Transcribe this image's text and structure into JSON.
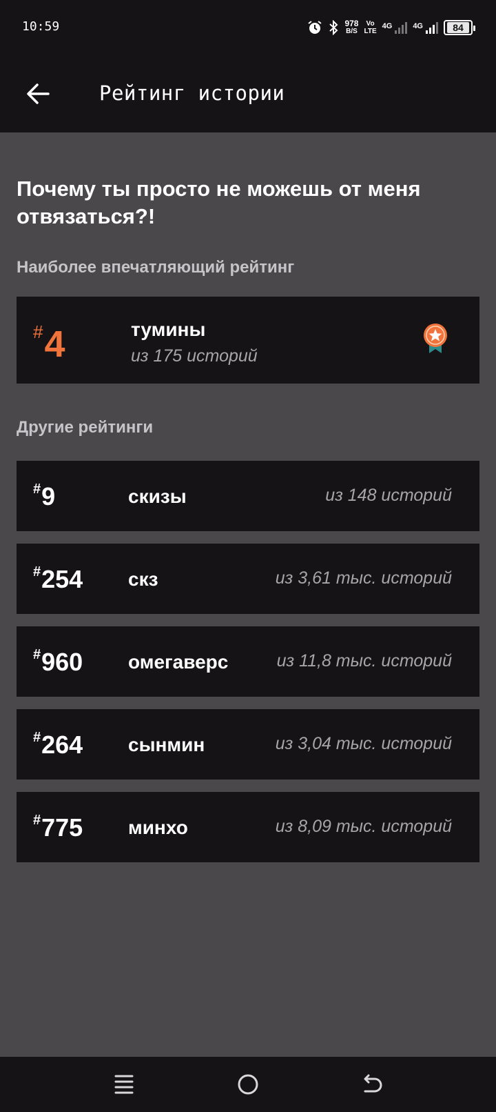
{
  "status_bar": {
    "time": "10:59",
    "speed_value": "978",
    "speed_unit": "B/S",
    "volte_top": "Vo",
    "volte_bottom": "LTE",
    "net1": "4G",
    "net2": "4G",
    "battery": "84",
    "icons": [
      "alarm-icon",
      "bluetooth-icon",
      "signal-icon",
      "battery-icon"
    ]
  },
  "app_bar": {
    "title": "Рейтинг истории",
    "back_icon": "arrow-left-icon"
  },
  "story": {
    "title": "Почему ты просто не можешь от меня отвязаться?!"
  },
  "best": {
    "label": "Наиболее впечатляющий рейтинг",
    "hash": "#",
    "rank": "4",
    "tag": "тумины",
    "count": "из 175 историй",
    "icon": "medal-star-icon",
    "accent": "#f0743b"
  },
  "others": {
    "label": "Другие рейтинги",
    "items": [
      {
        "hash": "#",
        "rank": "9",
        "tag": "скизы",
        "count": "из 148 историй"
      },
      {
        "hash": "#",
        "rank": "254",
        "tag": "скз",
        "count": "из 3,61 тыс. историй"
      },
      {
        "hash": "#",
        "rank": "960",
        "tag": "омегаверс",
        "count": "из 11,8 тыс. историй"
      },
      {
        "hash": "#",
        "rank": "264",
        "tag": "сынмин",
        "count": "из 3,04 тыс. историй"
      },
      {
        "hash": "#",
        "rank": "775",
        "tag": "минхо",
        "count": "из 8,09 тыс. историй"
      }
    ]
  },
  "nav_bar": {
    "icons": [
      "menu-icon",
      "home-circle-icon",
      "back-nav-icon"
    ]
  }
}
